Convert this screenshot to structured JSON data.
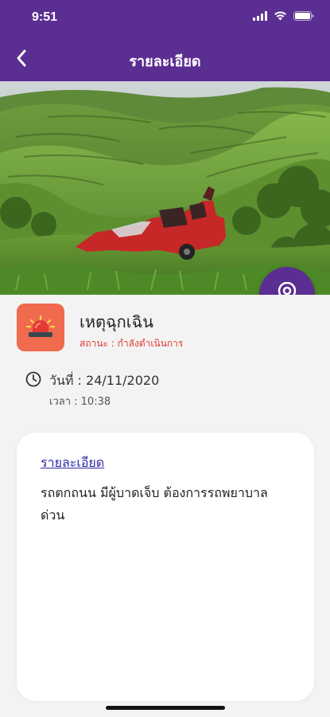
{
  "status_bar": {
    "time": "9:51"
  },
  "header": {
    "title": "รายละเอียด"
  },
  "incident": {
    "type": "เหตุฉุกเฉิน",
    "status_text": "สถานะ : กำลังดำเนินการ",
    "date_text": "วันที่ : 24/11/2020",
    "time_text": "เวลา : 10:38"
  },
  "details_card": {
    "heading": "รายละเอียด",
    "text": "รถตกถนน มีผู้บาดเจ็บ ต้องการรถพยาบาล ด่วน"
  },
  "colors": {
    "primary": "#5b2e91",
    "incident_icon_bg": "#f06a4d",
    "status_red": "#e53935",
    "link_blue": "#2d2aa6"
  },
  "icons": [
    "back-chevron-icon",
    "signal-icon",
    "wifi-icon",
    "battery-icon",
    "siren-icon",
    "clock-icon",
    "location-pin-icon"
  ]
}
